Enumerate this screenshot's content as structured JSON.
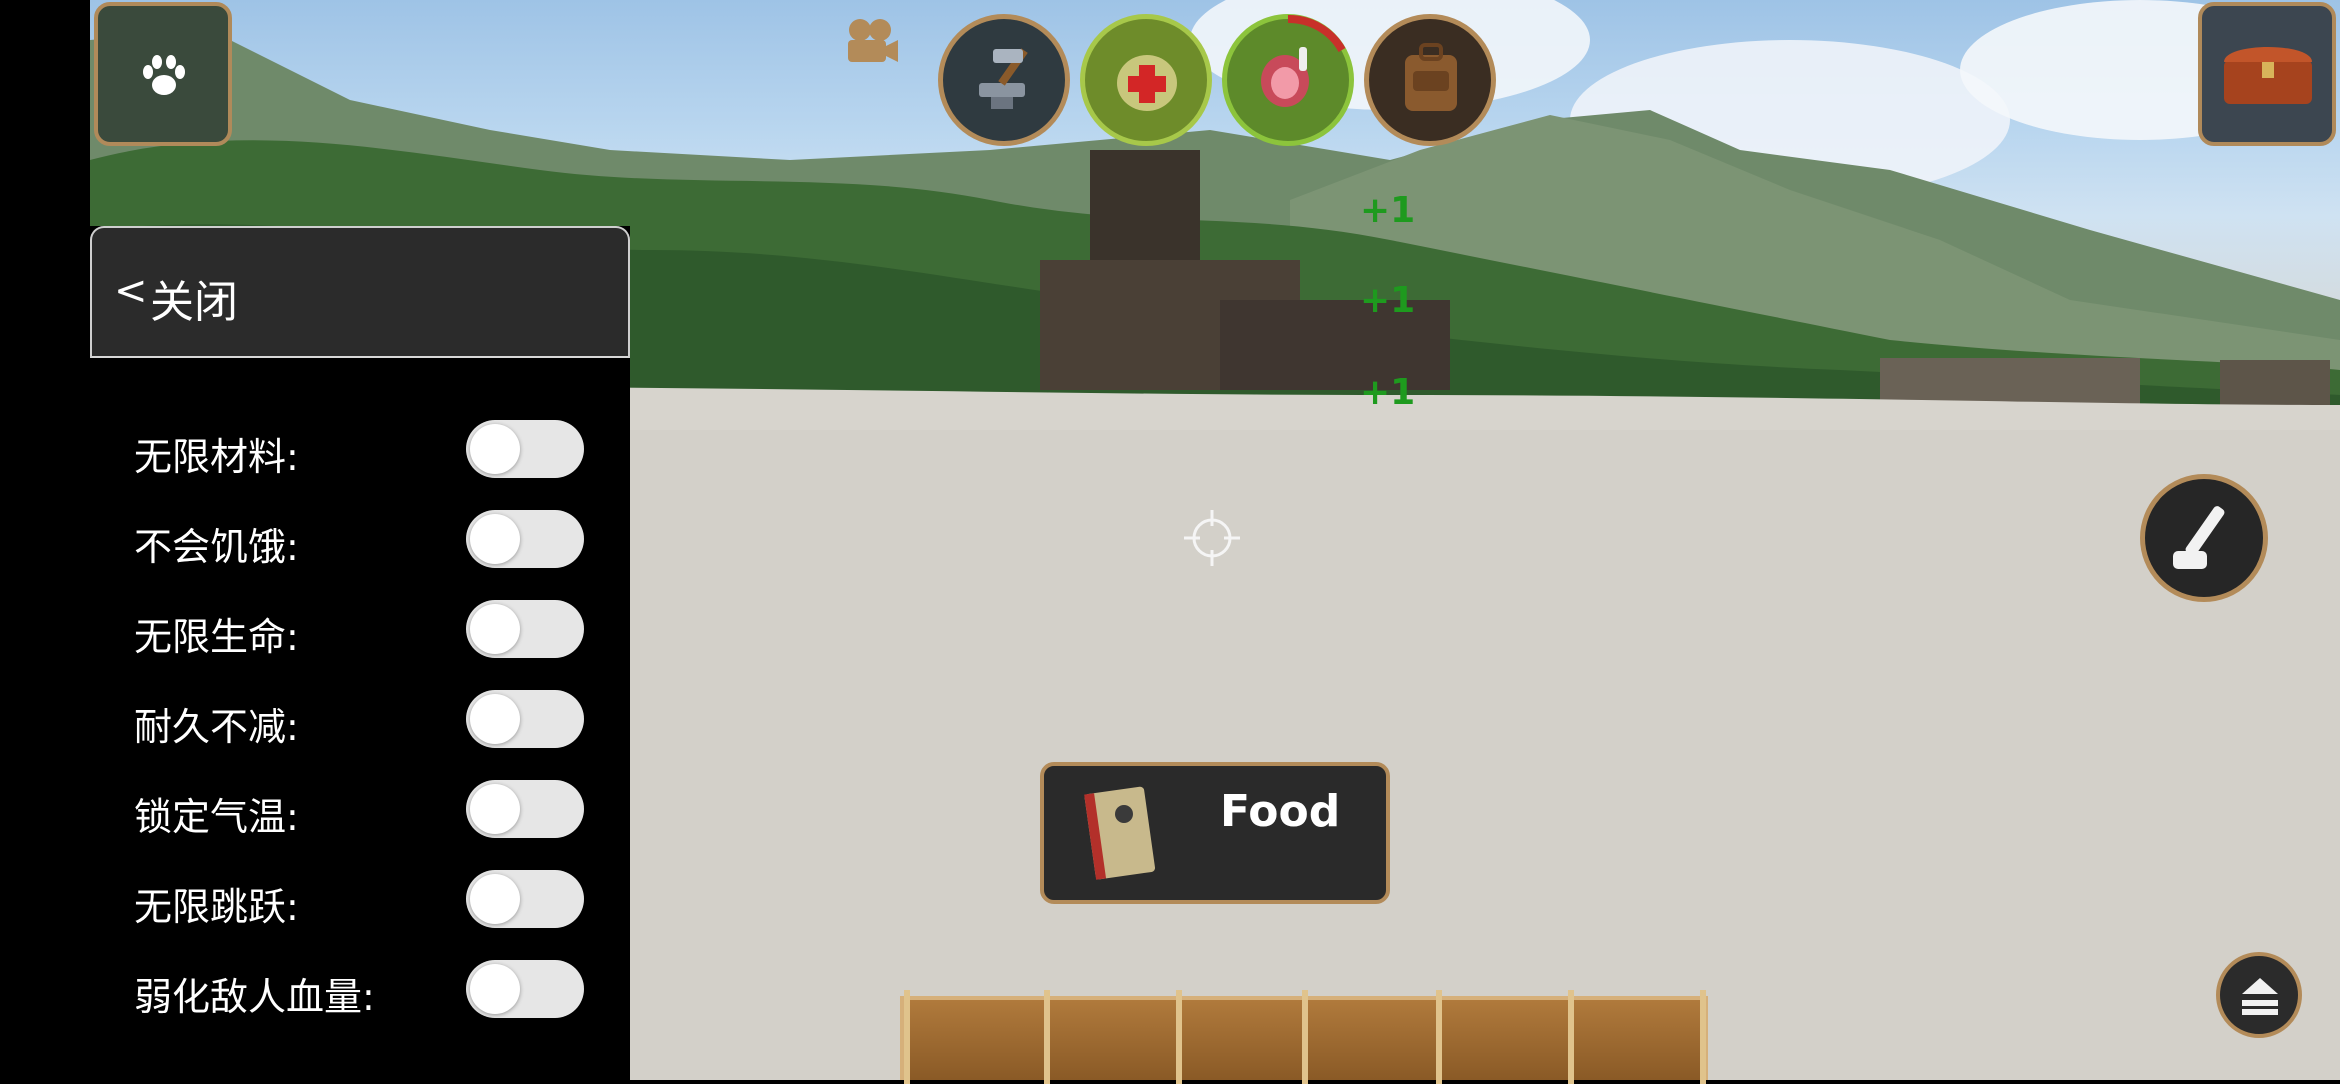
{
  "hud": {
    "paw_icon": "paw-icon",
    "camera_icon": "movie-camera-icon",
    "top_buttons": [
      "anvil-hammer-icon",
      "medkit-bag-icon",
      "meat-icon",
      "backpack-icon"
    ],
    "chest_icon": "chest-icon",
    "hammer_action_icon": "hammer-icon",
    "eject_icon": "eject-icon",
    "crosshair_icon": "crosshair-icon"
  },
  "pickup_notices": [
    "+1",
    "+1",
    "+1"
  ],
  "tooltip": {
    "label": "Food",
    "icon": "journal-book-icon"
  },
  "cheat_panel": {
    "close_chevron": "<",
    "close_label": "关闭",
    "options": [
      {
        "label": "无限材料:",
        "enabled": false
      },
      {
        "label": "不会饥饿:",
        "enabled": false
      },
      {
        "label": "无限生命:",
        "enabled": false
      },
      {
        "label": "耐久不减:",
        "enabled": false
      },
      {
        "label": "锁定气温:",
        "enabled": false
      },
      {
        "label": "无限跳跃:",
        "enabled": false
      },
      {
        "label": "弱化敌人血量:",
        "enabled": false
      }
    ]
  },
  "colors": {
    "toggle_off": "#e6e6e6",
    "panel_bg": "#000000",
    "header_bg": "#2b2b2b",
    "accent_gold": "#b38b59",
    "pickup_green": "#1e9a1e"
  }
}
